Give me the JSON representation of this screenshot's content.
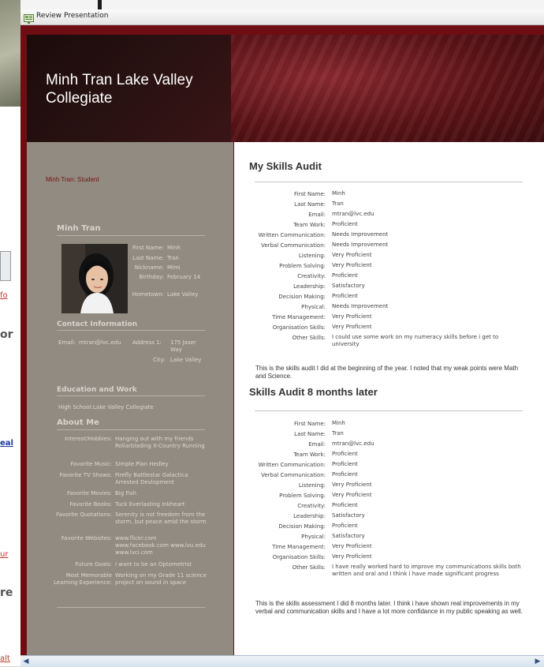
{
  "window": {
    "title": "Review Presentation"
  },
  "background_fragments": [
    {
      "text": "fo"
    },
    {
      "text": "or"
    },
    {
      "text": "eal"
    },
    {
      "text": "ur"
    },
    {
      "text": "re"
    },
    {
      "text": "alt"
    }
  ],
  "header": {
    "title": "Minh Tran Lake Valley Collegiate"
  },
  "sidebar": {
    "role": "Minh Tran: Student",
    "profile_heading": "Minh Tran",
    "profile": [
      {
        "label": "First Name:",
        "value": "Minh"
      },
      {
        "label": "Last Name:",
        "value": "Tran"
      },
      {
        "label": "Nickname:",
        "value": "Mimi"
      },
      {
        "label": "Birthday:",
        "value": "February 14"
      },
      {
        "label": "Hometown:",
        "value": "Lake Valley"
      }
    ],
    "contact_heading": "Contact Information",
    "contact": {
      "email_label": "Email:",
      "email": "mtran@lvc.edu",
      "address_label": "Address 1:",
      "address": "175 Jaser Way",
      "city_label": "City:",
      "city": "Lake Valley"
    },
    "education_heading": "Education and Work",
    "education": {
      "label": "High School:",
      "value": "Lake Valley Collegiate"
    },
    "about_heading": "About Me",
    "about": [
      {
        "label": "Interest/Hobbies:",
        "value": "Hanging out with my friends Rollarblading X-Country Running"
      },
      {
        "label": "Favorite Music:",
        "value": "Simple Plan Hedley"
      },
      {
        "label": "Favorite TV Shows:",
        "value": "Firefly Battlestar Galactica Arrested Devlopment"
      },
      {
        "label": "Favorite Movies:",
        "value": "Big Fish"
      },
      {
        "label": "Favorite Books:",
        "value": "Tuck Everlasting Inkheart"
      },
      {
        "label": "Favorite Quotations:",
        "value": "Serenity is not freedom from the storm, but peace amid the storm"
      },
      {
        "label": "Favorite Websites:",
        "value": "www.flickr.com www.facebook.com www.lvu.edu www.lvci.com"
      },
      {
        "label": "Future Goals:",
        "value": "I want to be an Optometrist"
      },
      {
        "label": "Most Memorable Learning Experience:",
        "value": "Working on my Grade 11 science project on sound in space"
      }
    ]
  },
  "audit1": {
    "title": "My Skills Audit",
    "rows": [
      {
        "label": "First Name:",
        "value": "Minh"
      },
      {
        "label": "Last Name:",
        "value": "Tran"
      },
      {
        "label": "Email:",
        "value": "mtran@lvc.edu"
      },
      {
        "label": "Team Work:",
        "value": "Proficient"
      },
      {
        "label": "Written Communication:",
        "value": "Needs Improvement"
      },
      {
        "label": "Verbal Communication:",
        "value": "Needs Improvement"
      },
      {
        "label": "Listening:",
        "value": "Very Proficient"
      },
      {
        "label": "Problem Solving:",
        "value": "Very Proficient"
      },
      {
        "label": "Creativity:",
        "value": "Proficient"
      },
      {
        "label": "Leadership:",
        "value": "Satisfactory"
      },
      {
        "label": "Decision Making:",
        "value": "Proficient"
      },
      {
        "label": "Physical:",
        "value": "Needs Improvement"
      },
      {
        "label": "Time Management:",
        "value": "Very Proficient"
      },
      {
        "label": "Organisation Skills:",
        "value": "Very Proficient"
      },
      {
        "label": "Other Skills:",
        "value": "I could use some work on my numeracy skills before i get to university"
      }
    ],
    "note": "This is the skills audit I did at the beginning of the year. I noted that my weak points were Math and Science."
  },
  "audit2": {
    "title": "Skills Audit 8 months later",
    "rows": [
      {
        "label": "First Name:",
        "value": "Minh"
      },
      {
        "label": "Last Name:",
        "value": "Tran"
      },
      {
        "label": "Email:",
        "value": "mtran@lvc.edu"
      },
      {
        "label": "Team Work:",
        "value": "Proficient"
      },
      {
        "label": "Written Communication:",
        "value": "Proficient"
      },
      {
        "label": "Verbal Communication:",
        "value": "Proficient"
      },
      {
        "label": "Listening:",
        "value": "Very Proficient"
      },
      {
        "label": "Problem Solving:",
        "value": "Very Proficient"
      },
      {
        "label": "Creativity:",
        "value": "Proficient"
      },
      {
        "label": "Leadership:",
        "value": "Satisfactory"
      },
      {
        "label": "Decision Making:",
        "value": "Proficient"
      },
      {
        "label": "Physical:",
        "value": "Satisfactory"
      },
      {
        "label": "Time Management:",
        "value": "Very Proficient"
      },
      {
        "label": "Organisation Skills:",
        "value": "Very Proficient"
      },
      {
        "label": "Other Skills:",
        "value": "I have really worked hard to improve my communications skills both written and oral and I think i have made significant progress"
      }
    ],
    "note": "This is the skills assessment I did 8 months later. I think i have shown real improvements in my verbal and communication skills and I have a lot more confidance in my public speaking as well."
  },
  "icons": {
    "window": "presentation-window-icon",
    "scroll_left": "scroll-left-arrow-icon",
    "scroll_right": "scroll-right-arrow-icon"
  },
  "colors": {
    "frame": "#6e0e12",
    "sidebar": "#918b81",
    "role_text": "#7a1214"
  }
}
